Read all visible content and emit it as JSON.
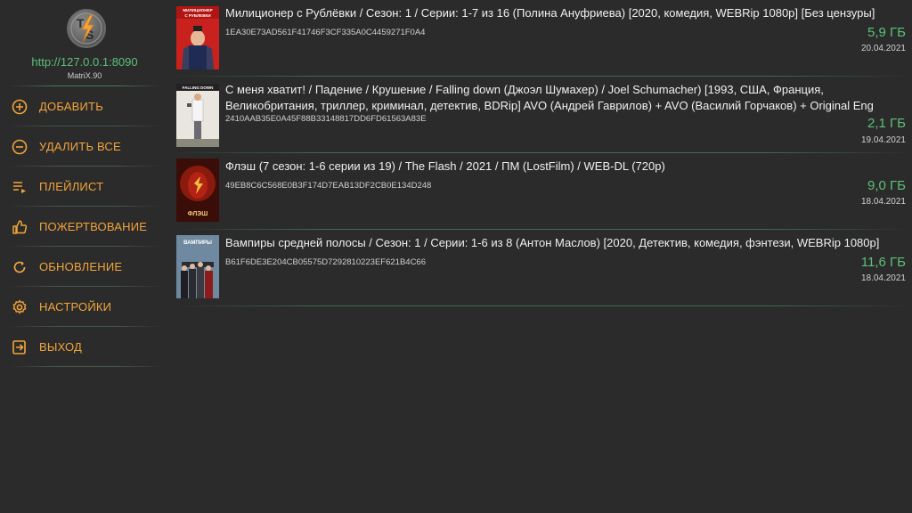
{
  "server": {
    "url": "http://127.0.0.1:8090",
    "version": "MatriX.90"
  },
  "logo": {
    "letters": "TS"
  },
  "colors": {
    "accent_orange": "#f2a43a",
    "accent_green": "#5cc07a",
    "background": "#2b2b2b"
  },
  "menu": [
    {
      "label": "ДОБАВИТЬ",
      "icon": "add-circle-icon"
    },
    {
      "label": "УДАЛИТЬ ВСЕ",
      "icon": "remove-circle-icon"
    },
    {
      "label": "ПЛЕЙЛИСТ",
      "icon": "playlist-icon"
    },
    {
      "label": "ПОЖЕРТВОВАНИЕ",
      "icon": "thumbs-up-icon"
    },
    {
      "label": "ОБНОВЛЕНИЕ",
      "icon": "refresh-icon"
    },
    {
      "label": "НАСТРОЙКИ",
      "icon": "gear-icon"
    },
    {
      "label": "ВЫХОД",
      "icon": "exit-icon"
    }
  ],
  "torrents": [
    {
      "title": "Милиционер с Рублёвки / Сезон: 1 / Серии: 1-7 из 16 (Полина Ануфриева) [2020, комедия, WEBRip 1080p] [Без цензуры]",
      "hash": "1EA30E73AD561F41746F3CF335A0C4459271F0A4",
      "size": "5,9 ГБ",
      "date": "20.04.2021",
      "poster_text": "МИЛИЦИОНЕР С РУБЛЕВКИ"
    },
    {
      "title": "С меня хватит! / Падение / Крушение / Falling down (Джоэл Шумахер) / Joel Schumacher) [1993, США, Франция, Великобритания, триллер, криминал, детектив, BDRip] AVO (Андрей Гаврилов) + AVO (Василий Горчаков) + Original Eng",
      "hash": "2410AAB35E0A45F88B33148817DD6FD61563A83E",
      "size": "2,1 ГБ",
      "date": "19.04.2021",
      "poster_text": "FALLING DOWN"
    },
    {
      "title": "Флэш (7 сезон: 1-6 серии из 19) / The Flash / 2021 / ПМ (LostFilm) / WEB-DL (720p)",
      "hash": "49EB8C6C568E0B3F174D7EAB13DF2CB0E134D248",
      "size": "9,0 ГБ",
      "date": "18.04.2021",
      "poster_text": "ФЛЭШ"
    },
    {
      "title": "Вампиры средней полосы / Сезон: 1 / Серии: 1-6 из 8 (Антон Маслов) [2020, Детектив, комедия, фэнтези, WEBRip 1080p]",
      "hash": "B61F6DE3E204CB05575D7292810223EF621B4C66",
      "size": "11,6 ГБ",
      "date": "18.04.2021",
      "poster_text": "ВАМПИРЫ"
    }
  ]
}
